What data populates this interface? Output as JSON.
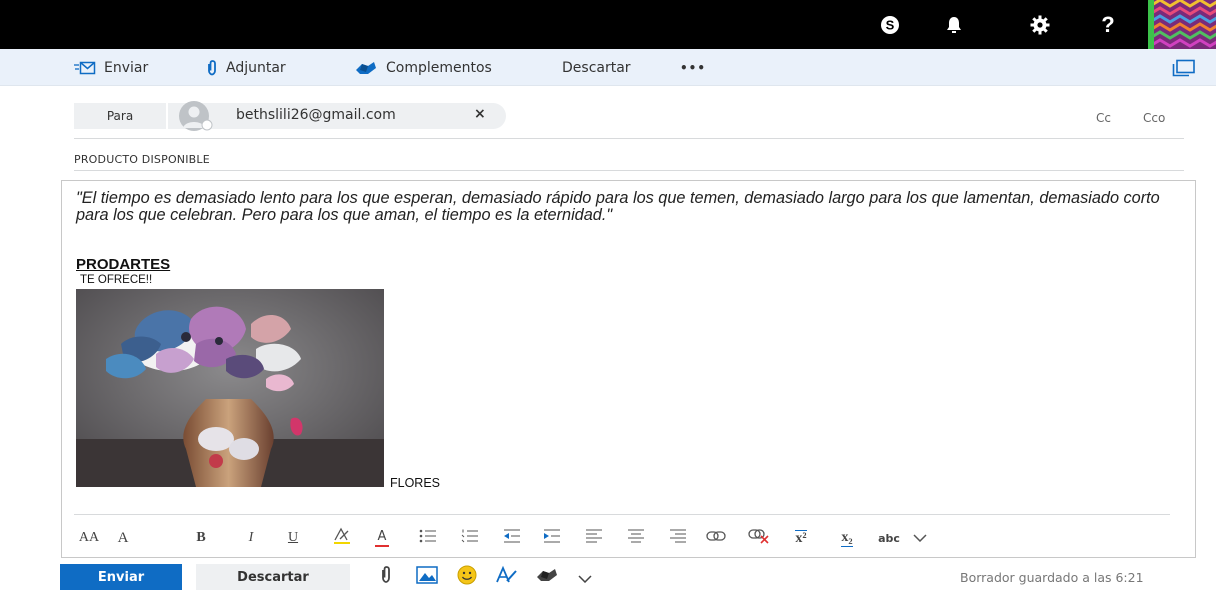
{
  "topbar": {
    "icons": [
      "skype-icon",
      "bell-icon",
      "gear-icon",
      "help-icon"
    ],
    "help_glyph": "?"
  },
  "toolbar": {
    "send_label": "Enviar",
    "attach_label": "Adjuntar",
    "addins_label": "Complementos",
    "discard_label": "Descartar",
    "more_label": "•••"
  },
  "compose": {
    "to_label": "Para",
    "recipient": "bethslili26@gmail.com",
    "remove_glyph": "×",
    "cc_label": "Cc",
    "bcc_label": "Cco",
    "subject": "PRODUCTO DISPONIBLE",
    "body": {
      "quote": "\"El tiempo es demasiado lento para los que esperan, demasiado rápido para los que temen, demasiado largo para los que lamentan, demasiado corto para los que celebran. Pero para los que aman, el tiempo es la eternidad.\"",
      "brand": "PRODARTES",
      "offer": "TE OFRECE!!",
      "caption": "FLORES"
    }
  },
  "format_toolbar": {
    "font_size_glyph": "AA",
    "grow_glyph": "A",
    "bold_glyph": "B",
    "italic_glyph": "I",
    "underline_glyph": "U",
    "font_color_glyph": "A",
    "superscript_glyph": "x²",
    "subscript_glyph": "x₂",
    "strike_glyph": "abc",
    "more_glyph": "⌄"
  },
  "footer": {
    "send_label": "Enviar",
    "discard_label": "Descartar",
    "draft_status": "Borrador guardado a las 6:21"
  },
  "colors": {
    "accent": "#0f6cc4",
    "command_bar": "#eaf1fa",
    "presence": "#3cc24a"
  }
}
